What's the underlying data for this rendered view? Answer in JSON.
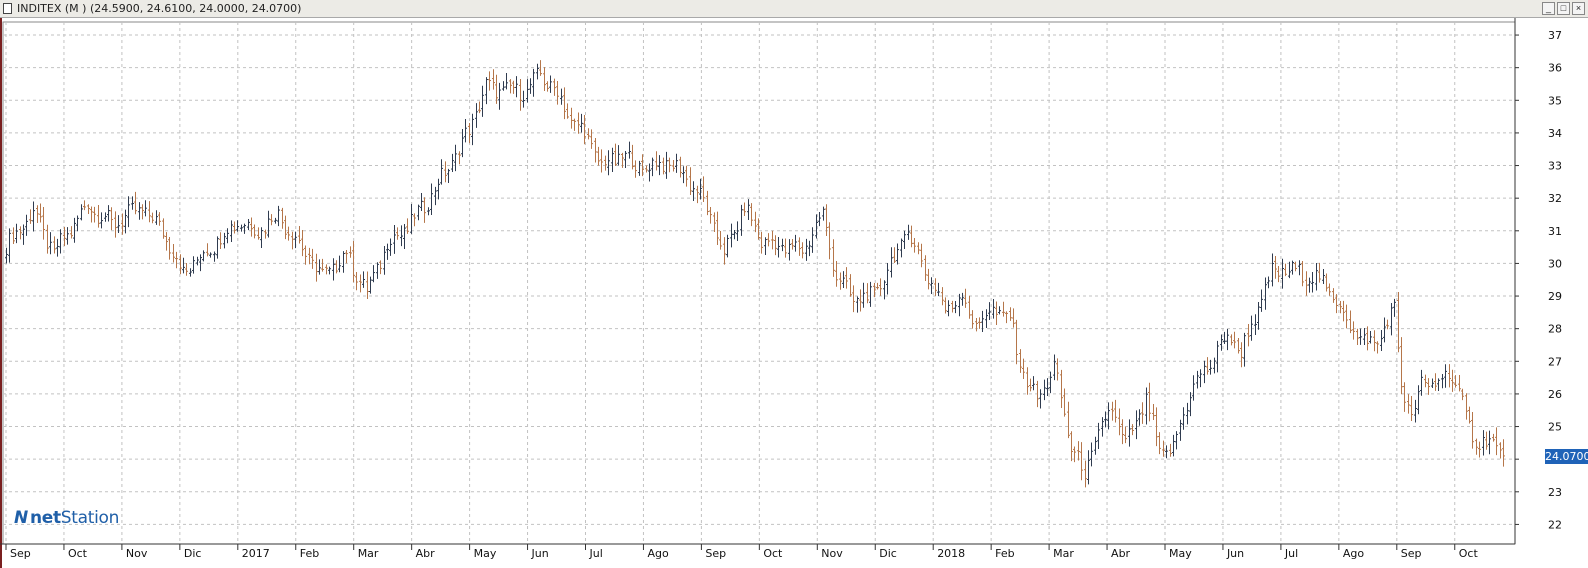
{
  "window": {
    "title": "INDITEX (M ) (24.5900, 24.6100, 24.0000, 24.0700)",
    "min_label": "_",
    "max_label": "□",
    "close_label": "×"
  },
  "logo": {
    "net": "net",
    "station": "Station",
    "mark": "N"
  },
  "last_price": "24.0700",
  "colors": {
    "up": "#2f3b4f",
    "down": "#b5764a",
    "grid": "#c2c2c2",
    "price_tag": "#1f63b8",
    "logo": "#1f5fa8"
  },
  "chart_data": {
    "type": "ohlc",
    "ylim": [
      21.4,
      37.4
    ],
    "yticks": [
      22,
      23,
      24,
      25,
      26,
      27,
      28,
      29,
      30,
      31,
      32,
      33,
      34,
      35,
      36,
      37
    ],
    "xticks": [
      "Sep",
      "Oct",
      "Nov",
      "Dic",
      "2017",
      "Feb",
      "Mar",
      "Abr",
      "May",
      "Jun",
      "Jul",
      "Ago",
      "Sep",
      "Oct",
      "Nov",
      "Dic",
      "2018",
      "Feb",
      "Mar",
      "Abr",
      "May",
      "Jun",
      "Jul",
      "Ago",
      "Sep",
      "Oct"
    ],
    "anchors": [
      {
        "i": 0,
        "v": 30.5
      },
      {
        "i": 8,
        "v": 31.6
      },
      {
        "i": 14,
        "v": 30.3
      },
      {
        "i": 24,
        "v": 31.8
      },
      {
        "i": 31,
        "v": 31.2
      },
      {
        "i": 40,
        "v": 31.7
      },
      {
        "i": 46,
        "v": 31.0
      },
      {
        "i": 52,
        "v": 29.7
      },
      {
        "i": 60,
        "v": 30.5
      },
      {
        "i": 68,
        "v": 31.3
      },
      {
        "i": 74,
        "v": 31.0
      },
      {
        "i": 80,
        "v": 31.5
      },
      {
        "i": 86,
        "v": 30.6
      },
      {
        "i": 93,
        "v": 29.6
      },
      {
        "i": 100,
        "v": 30.3
      },
      {
        "i": 106,
        "v": 29.1
      },
      {
        "i": 112,
        "v": 30.6
      },
      {
        "i": 118,
        "v": 31.1
      },
      {
        "i": 125,
        "v": 32.1
      },
      {
        "i": 132,
        "v": 33.3
      },
      {
        "i": 136,
        "v": 34.1
      },
      {
        "i": 141,
        "v": 35.4
      },
      {
        "i": 147,
        "v": 35.3
      },
      {
        "i": 153,
        "v": 35.3
      },
      {
        "i": 157,
        "v": 35.8
      },
      {
        "i": 162,
        "v": 35.2
      },
      {
        "i": 166,
        "v": 34.4
      },
      {
        "i": 170,
        "v": 34.0
      },
      {
        "i": 175,
        "v": 33.0
      },
      {
        "i": 181,
        "v": 33.3
      },
      {
        "i": 187,
        "v": 32.9
      },
      {
        "i": 193,
        "v": 33.1
      },
      {
        "i": 199,
        "v": 32.8
      },
      {
        "i": 206,
        "v": 31.7
      },
      {
        "i": 211,
        "v": 30.3
      },
      {
        "i": 217,
        "v": 31.7
      },
      {
        "i": 222,
        "v": 30.7
      },
      {
        "i": 228,
        "v": 30.5
      },
      {
        "i": 234,
        "v": 30.4
      },
      {
        "i": 240,
        "v": 31.5
      },
      {
        "i": 244,
        "v": 29.6
      },
      {
        "i": 249,
        "v": 28.9
      },
      {
        "i": 255,
        "v": 29.0
      },
      {
        "i": 261,
        "v": 30.2
      },
      {
        "i": 265,
        "v": 31.0
      },
      {
        "i": 270,
        "v": 29.8
      },
      {
        "i": 276,
        "v": 28.6
      },
      {
        "i": 281,
        "v": 29.0
      },
      {
        "i": 285,
        "v": 28.1
      },
      {
        "i": 290,
        "v": 28.6
      },
      {
        "i": 295,
        "v": 28.3
      },
      {
        "i": 299,
        "v": 26.6
      },
      {
        "i": 303,
        "v": 25.8
      },
      {
        "i": 308,
        "v": 26.8
      },
      {
        "i": 313,
        "v": 24.4
      },
      {
        "i": 317,
        "v": 23.5
      },
      {
        "i": 320,
        "v": 24.5
      },
      {
        "i": 325,
        "v": 25.6
      },
      {
        "i": 329,
        "v": 24.4
      },
      {
        "i": 335,
        "v": 25.8
      },
      {
        "i": 339,
        "v": 24.2
      },
      {
        "i": 343,
        "v": 24.3
      },
      {
        "i": 348,
        "v": 26.1
      },
      {
        "i": 353,
        "v": 26.8
      },
      {
        "i": 359,
        "v": 27.8
      },
      {
        "i": 363,
        "v": 27.3
      },
      {
        "i": 368,
        "v": 28.6
      },
      {
        "i": 372,
        "v": 29.7
      },
      {
        "i": 376,
        "v": 29.8
      },
      {
        "i": 381,
        "v": 29.7
      },
      {
        "i": 386,
        "v": 29.5
      },
      {
        "i": 392,
        "v": 28.7
      },
      {
        "i": 398,
        "v": 27.6
      },
      {
        "i": 403,
        "v": 27.6
      },
      {
        "i": 408,
        "v": 28.6
      },
      {
        "i": 410,
        "v": 26.4
      },
      {
        "i": 413,
        "v": 25.1
      },
      {
        "i": 416,
        "v": 26.4
      },
      {
        "i": 420,
        "v": 26.2
      },
      {
        "i": 424,
        "v": 26.8
      },
      {
        "i": 429,
        "v": 25.3
      },
      {
        "i": 433,
        "v": 24.4
      },
      {
        "i": 437,
        "v": 24.6
      },
      {
        "i": 440,
        "v": 24.1
      }
    ]
  }
}
